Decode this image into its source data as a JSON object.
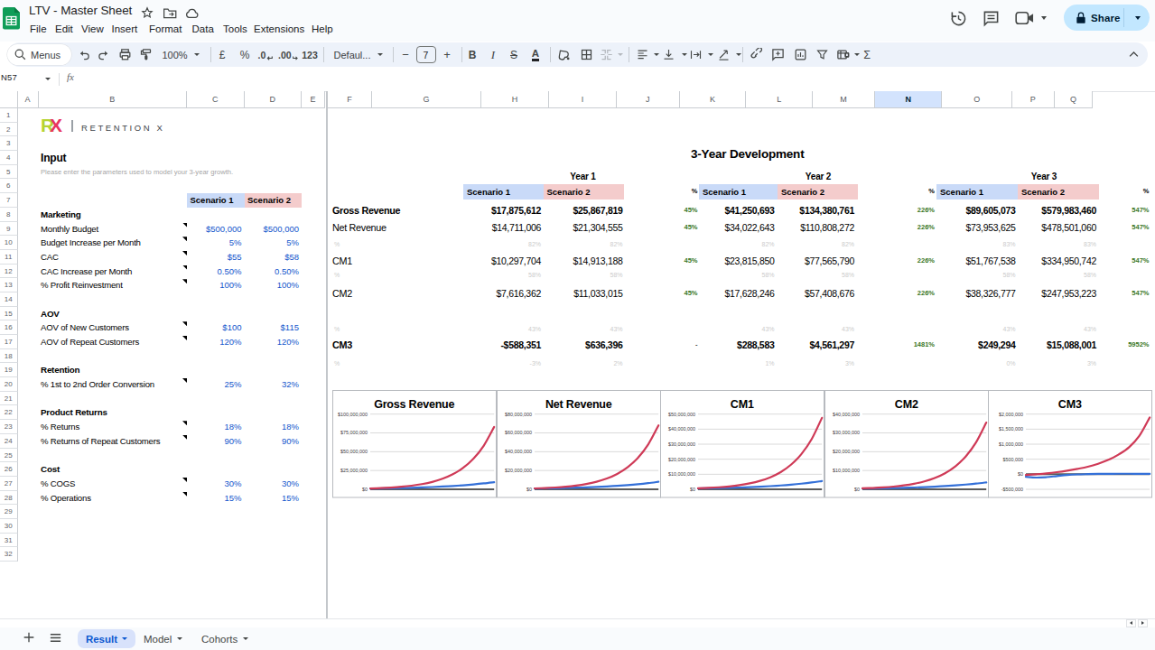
{
  "titlebar": {
    "title": "LTV - Master Sheet",
    "menus": [
      "File",
      "Edit",
      "View",
      "Insert",
      "Format",
      "Data",
      "Tools",
      "Extensions",
      "Help"
    ],
    "share_label": "Share"
  },
  "toolbar": {
    "menus_label": "Menus",
    "zoom": "100%",
    "currency": "£",
    "percent": "%",
    "decrease_decimal": ".0",
    "increase_decimal": ".00",
    "more_formats": "123",
    "font_name": "Defaul...",
    "font_size": "7",
    "minus": "−",
    "plus": "+",
    "bold": "B",
    "italic": "I",
    "strikethrough": "S",
    "text_color": "A",
    "functions": "Σ"
  },
  "formula_bar": {
    "cell_ref": "N57",
    "fx_label": "fx"
  },
  "grid": {
    "columns": [
      "A",
      "B",
      "C",
      "D",
      "E",
      "F",
      "G",
      "H",
      "I",
      "J",
      "K",
      "L",
      "M",
      "N",
      "O",
      "P",
      "Q"
    ],
    "selected_column": "N",
    "row_count": 32
  },
  "left_pane": {
    "logo": {
      "r": "R",
      "x": "X",
      "text": "RETENTION X"
    },
    "heading": "Input",
    "subtitle": "Please enter the parameters used to model your 3-year growth.",
    "scenario_labels": [
      "Scenario 1",
      "Scenario 2"
    ],
    "rows": [
      {
        "row": 8,
        "type": "section",
        "label": "Marketing"
      },
      {
        "row": 9,
        "type": "item",
        "label": "Monthly Budget",
        "v1": "$500,000",
        "v2": "$500,000",
        "note": true
      },
      {
        "row": 10,
        "type": "item",
        "label": "Budget Increase per Month",
        "v1": "5%",
        "v2": "5%",
        "note": true
      },
      {
        "row": 11,
        "type": "item",
        "label": "CAC",
        "v1": "$55",
        "v2": "$58",
        "note": true
      },
      {
        "row": 12,
        "type": "item",
        "label": "CAC Increase per Month",
        "v1": "0.50%",
        "v2": "0.50%",
        "note": true
      },
      {
        "row": 13,
        "type": "item",
        "label": "% Profit Reinvestment",
        "v1": "100%",
        "v2": "100%",
        "note": true
      },
      {
        "row": 15,
        "type": "section",
        "label": "AOV"
      },
      {
        "row": 16,
        "type": "item",
        "label": "AOV of New Customers",
        "v1": "$100",
        "v2": "$115",
        "note": true
      },
      {
        "row": 17,
        "type": "item",
        "label": "AOV of Repeat Customers",
        "v1": "120%",
        "v2": "120%",
        "note": true
      },
      {
        "row": 19,
        "type": "section",
        "label": "Retention"
      },
      {
        "row": 20,
        "type": "item",
        "label": "% 1st to 2nd Order Conversion",
        "v1": "25%",
        "v2": "32%",
        "note": true
      },
      {
        "row": 22,
        "type": "section",
        "label": "Product Returns"
      },
      {
        "row": 23,
        "type": "item",
        "label": "% Returns",
        "v1": "18%",
        "v2": "18%",
        "note": true
      },
      {
        "row": 24,
        "type": "item",
        "label": "% Returns of Repeat Customers",
        "v1": "90%",
        "v2": "90%",
        "note": true
      },
      {
        "row": 26,
        "type": "section",
        "label": "Cost"
      },
      {
        "row": 27,
        "type": "item",
        "label": "% COGS",
        "v1": "30%",
        "v2": "30%",
        "note": true
      },
      {
        "row": 28,
        "type": "item",
        "label": "% Operations",
        "v1": "15%",
        "v2": "15%",
        "note": true
      }
    ]
  },
  "main_table": {
    "title": "3-Year Development",
    "years": [
      "Year 1",
      "Year 2",
      "Year 3"
    ],
    "scenario_labels": [
      "Scenario 1",
      "Scenario 2"
    ],
    "pct_header": "%",
    "rows": [
      {
        "label": "Gross Revenue",
        "bold": true,
        "kind": "money",
        "values": [
          "$17,875,612",
          "$25,867,819",
          "45%",
          "$41,250,693",
          "$134,380,761",
          "226%",
          "$89,605,073",
          "$579,983,460",
          "547%"
        ]
      },
      {
        "label": "Net Revenue",
        "bold": false,
        "kind": "money",
        "values": [
          "$14,711,006",
          "$21,304,555",
          "45%",
          "$34,022,643",
          "$110,808,272",
          "226%",
          "$73,953,625",
          "$478,501,060",
          "547%"
        ]
      },
      {
        "label": "%",
        "kind": "pct",
        "values": [
          "82%",
          "82%",
          "",
          "82%",
          "82%",
          "",
          "83%",
          "83%",
          ""
        ]
      },
      {
        "label": "CM1",
        "bold": false,
        "kind": "money",
        "values": [
          "$10,297,704",
          "$14,913,188",
          "45%",
          "$23,815,850",
          "$77,565,790",
          "226%",
          "$51,767,538",
          "$334,950,742",
          "547%"
        ]
      },
      {
        "label": "%",
        "kind": "pct",
        "values": [
          "58%",
          "58%",
          "",
          "58%",
          "58%",
          "",
          "58%",
          "58%",
          ""
        ]
      },
      {
        "label": "CM2",
        "bold": false,
        "kind": "money",
        "values": [
          "$7,616,362",
          "$11,033,015",
          "45%",
          "$17,628,246",
          "$57,408,676",
          "226%",
          "$38,326,777",
          "$247,953,223",
          "547%"
        ]
      },
      {
        "label": "%",
        "kind": "pct",
        "values": [
          "43%",
          "43%",
          "",
          "43%",
          "43%",
          "",
          "43%",
          "43%",
          ""
        ]
      },
      {
        "label": "CM3",
        "bold": true,
        "kind": "money",
        "values": [
          "-$588,351",
          "$636,396",
          "-",
          "$288,583",
          "$4,561,297",
          "1481%",
          "$249,294",
          "$15,088,001",
          "5952%"
        ]
      },
      {
        "label": "%",
        "kind": "pct",
        "values": [
          "-3%",
          "2%",
          "",
          "1%",
          "3%",
          "",
          "0%",
          "3%",
          ""
        ]
      }
    ]
  },
  "chart_data": [
    {
      "type": "line",
      "title": "Gross Revenue",
      "x": [
        0,
        3,
        6,
        9,
        12,
        15,
        18,
        21,
        24,
        27,
        30,
        33,
        36
      ],
      "xlabel": "",
      "ylabel": "",
      "y_ticks": [
        "$100,000,000",
        "$75,000,000",
        "$50,000,000",
        "$25,000,000",
        "$0"
      ],
      "y_tick_values": [
        100000000,
        75000000,
        50000000,
        25000000,
        0
      ],
      "ylim": [
        0,
        100000000
      ],
      "grid": true,
      "legend": "none",
      "series": [
        {
          "name": "Scenario 1",
          "color": "#3470d8",
          "values": [
            952000,
            1153000,
            1397000,
            1692000,
            2050000,
            2483000,
            3008000,
            3644000,
            4414000,
            5347000,
            6477000,
            7846000,
            9500000
          ]
        },
        {
          "name": "Scenario 2",
          "color": "#cf3a57",
          "values": [
            1158000,
            1654000,
            2361000,
            3371000,
            4813000,
            6871000,
            9810000,
            14005000,
            19995000,
            28546000,
            40754000,
            58183000,
            83000000
          ]
        }
      ]
    },
    {
      "type": "line",
      "title": "Net Revenue",
      "x": [
        0,
        3,
        6,
        9,
        12,
        15,
        18,
        21,
        24,
        27,
        30,
        33,
        36
      ],
      "xlabel": "",
      "ylabel": "",
      "y_ticks": [
        "$80,000,000",
        "$60,000,000",
        "$40,000,000",
        "$20,000,000",
        "$0"
      ],
      "y_tick_values": [
        80000000,
        60000000,
        40000000,
        20000000,
        0
      ],
      "ylim": [
        0,
        80000000
      ],
      "grid": true,
      "legend": "none",
      "series": [
        {
          "name": "Scenario 1",
          "color": "#3470d8",
          "values": [
            801000,
            971000,
            1176000,
            1425000,
            1726000,
            2091000,
            2533000,
            3068000,
            3717000,
            4502000,
            5454000,
            6607000,
            8000000
          ]
        },
        {
          "name": "Scenario 2",
          "color": "#cf3a57",
          "values": [
            949000,
            1355000,
            1934000,
            2762000,
            3943000,
            5629000,
            8037000,
            11474000,
            16381000,
            23387000,
            33389000,
            47668000,
            68000000
          ]
        }
      ]
    },
    {
      "type": "line",
      "title": "CM1",
      "x": [
        0,
        3,
        6,
        9,
        12,
        15,
        18,
        21,
        24,
        27,
        30,
        33,
        36
      ],
      "xlabel": "",
      "ylabel": "",
      "y_ticks": [
        "$50,000,000",
        "$40,000,000",
        "$30,000,000",
        "$20,000,000",
        "$10,000,000",
        "$0"
      ],
      "y_tick_values": [
        50000000,
        40000000,
        30000000,
        20000000,
        10000000,
        0
      ],
      "ylim": [
        0,
        50000000
      ],
      "grid": true,
      "legend": "none",
      "series": [
        {
          "name": "Scenario 1",
          "color": "#3470d8",
          "values": [
            551000,
            668000,
            809000,
            980000,
            1187000,
            1437000,
            1741000,
            2109000,
            2555000,
            3095000,
            3749000,
            4541000,
            5500000
          ]
        },
        {
          "name": "Scenario 2",
          "color": "#cf3a57",
          "values": [
            663000,
            947000,
            1351000,
            1929000,
            2754000,
            3932000,
            5614000,
            8015000,
            11443000,
            16337000,
            23323000,
            33297000,
            47500000
          ]
        }
      ]
    },
    {
      "type": "line",
      "title": "CM2",
      "x": [
        0,
        3,
        6,
        9,
        12,
        15,
        18,
        21,
        24,
        27,
        30,
        33,
        36
      ],
      "xlabel": "",
      "ylabel": "",
      "y_ticks": [
        "$40,000,000",
        "$30,000,000",
        "$20,000,000",
        "$10,000,000",
        "$0"
      ],
      "y_tick_values": [
        40000000,
        30000000,
        20000000,
        10000000,
        0
      ],
      "ylim": [
        0,
        40000000
      ],
      "grid": true,
      "legend": "none",
      "series": [
        {
          "name": "Scenario 1",
          "color": "#3470d8",
          "values": [
            371000,
            449000,
            544000,
            659000,
            798000,
            967000,
            1172000,
            1419000,
            1719000,
            2082000,
            2523000,
            3056000,
            3700000
          ]
        },
        {
          "name": "Scenario 2",
          "color": "#cf3a57",
          "values": [
            495000,
            708000,
            1010000,
            1442000,
            2059000,
            2939000,
            4196000,
            5990000,
            8552000,
            12210000,
            17431000,
            24885000,
            35500000
          ]
        }
      ]
    },
    {
      "type": "line",
      "title": "CM3",
      "x": [
        0,
        3,
        6,
        9,
        12,
        15,
        18,
        21,
        24,
        27,
        30,
        33,
        36
      ],
      "xlabel": "",
      "ylabel": "",
      "y_ticks": [
        "$2,000,000",
        "$1,500,000",
        "$1,000,000",
        "$500,000",
        "$0",
        "-$500,000"
      ],
      "y_tick_values": [
        2000000,
        1500000,
        1000000,
        500000,
        0,
        -500000
      ],
      "ylim": [
        -500000,
        2000000
      ],
      "grid": true,
      "legend": "none",
      "series": [
        {
          "name": "Scenario 1",
          "color": "#3470d8",
          "values": [
            -85000,
            -110000,
            -95000,
            -60000,
            -25000,
            -5000,
            5000,
            12000,
            15000,
            18000,
            18000,
            15000,
            12000
          ]
        },
        {
          "name": "Scenario 2",
          "color": "#cf3a57",
          "values": [
            -25000,
            0,
            30000,
            70000,
            120000,
            180000,
            250000,
            350000,
            480000,
            660000,
            900000,
            1280000,
            1890000
          ]
        }
      ]
    }
  ],
  "sheet_tabs": {
    "tabs": [
      {
        "label": "Result",
        "active": true
      },
      {
        "label": "Model",
        "active": false
      },
      {
        "label": "Cohorts",
        "active": false
      }
    ]
  }
}
